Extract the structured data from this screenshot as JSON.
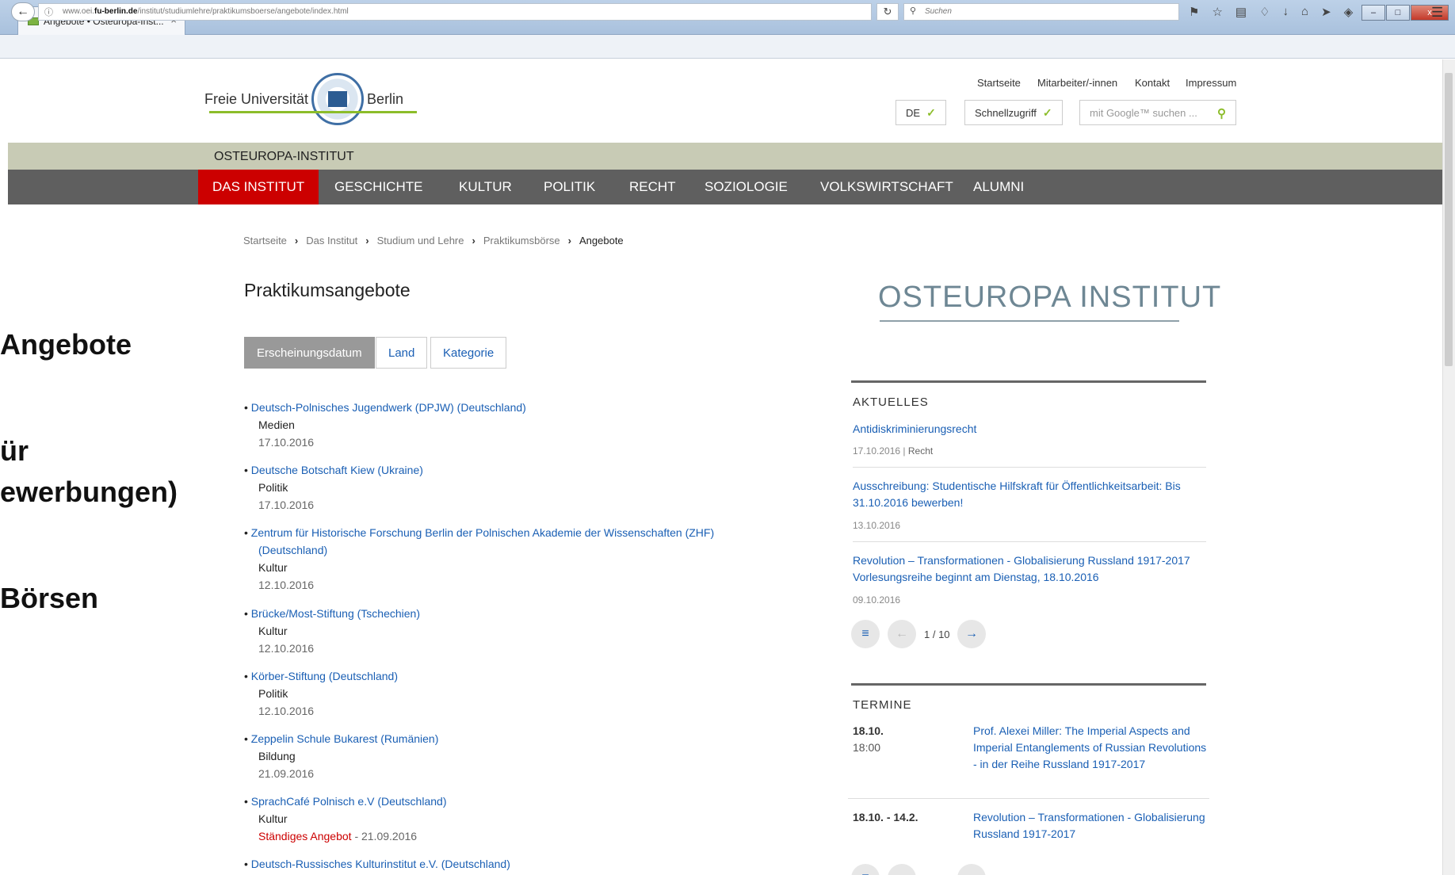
{
  "browser": {
    "tab_title": "Angebote • Osteuropa-Inst...",
    "tab_close": "×",
    "new_tab": "+",
    "url_prefix": "www.oei.",
    "url_domain": "fu-berlin.de",
    "url_path": "/institut/studiumlehre/praktikumsboerse/angebote/index.html",
    "search_placeholder": "Suchen",
    "window_buttons": [
      "–",
      "□",
      "x"
    ]
  },
  "header": {
    "logo_left": "Freie Universität",
    "logo_right": "Berlin",
    "meta_links": [
      "Startseite",
      "Mitarbeiter/-innen",
      "Kontakt",
      "Impressum"
    ],
    "lang_label": "DE",
    "quickaccess_label": "Schnellzugriff",
    "google_placeholder": "mit Google™ suchen ..."
  },
  "institute": {
    "name": "OSTEUROPA-INSTITUT"
  },
  "mainnav": [
    "DAS INSTITUT",
    "GESCHICHTE",
    "KULTUR",
    "POLITIK",
    "RECHT",
    "SOZIOLOGIE",
    "VOLKSWIRTSCHAFT",
    "ALUMNI"
  ],
  "breadcrumb": [
    "Startseite",
    "Das Institut",
    "Studium und Lehre",
    "Praktikumsbörse",
    "Angebote"
  ],
  "left_overflow": [
    "Angebote",
    "ür",
    "ewerbungen)",
    "Börsen"
  ],
  "main": {
    "title": "Praktikumsangebote",
    "filters": [
      "Erscheinungsdatum",
      "Land",
      "Kategorie"
    ],
    "offers": [
      {
        "title": "Deutsch-Polnisches Jugendwerk (DPJW) (Deutschland)",
        "category": "Medien",
        "date": "17.10.2016"
      },
      {
        "title": "Deutsche Botschaft Kiew (Ukraine)",
        "category": "Politik",
        "date": "17.10.2016"
      },
      {
        "title": "Zentrum für Historische Forschung Berlin der Polnischen Akademie der Wissenschaften (ZHF)",
        "title2": "(Deutschland)",
        "category": "Kultur",
        "date": "12.10.2016"
      },
      {
        "title": "Brücke/Most-Stiftung (Tschechien)",
        "category": "Kultur",
        "date": "12.10.2016"
      },
      {
        "title": "Körber-Stiftung (Deutschland)",
        "category": "Politik",
        "date": "12.10.2016"
      },
      {
        "title": "Zeppelin Schule Bukarest (Rumänien)",
        "category": "Bildung",
        "date": "21.09.2016"
      },
      {
        "title": "SprachCafé Polnisch e.V (Deutschland)",
        "category": "Kultur",
        "standing": "Ständiges Angebot",
        "date": "- 21.09.2016"
      },
      {
        "title": "Deutsch-Russisches Kulturinstitut e.V. (Deutschland)"
      }
    ]
  },
  "side": {
    "logo_text": "OSTEUROPA INSTITUT",
    "news_heading": "AKTUELLES",
    "news": [
      {
        "title": "Antidiskriminierungsrecht",
        "date": "17.10.2016 |",
        "category": "Recht"
      },
      {
        "title": "Ausschreibung: Studentische Hilfskraft für Öffentlichkeitsarbeit: Bis 31.10.2016 bewerben!",
        "date": "13.10.2016"
      },
      {
        "title": "Revolution – Transformationen - Globalisierung Russland 1917-2017 Vorlesungsreihe beginnt am Dienstag, 18.10.2016",
        "date": "09.10.2016"
      }
    ],
    "pager": "1 / 10",
    "events_heading": "TERMINE",
    "events": [
      {
        "date": "18.10.",
        "time": "18:00",
        "title": "Prof. Alexei Miller: The Imperial Aspects and Imperial Entanglements of Russian Revolutions - in der Reihe Russland 1917-2017"
      },
      {
        "date": "18.10. - 14.2.",
        "time": "",
        "title": "Revolution – Transformationen - Globalisierung Russland 1917-2017"
      }
    ]
  }
}
